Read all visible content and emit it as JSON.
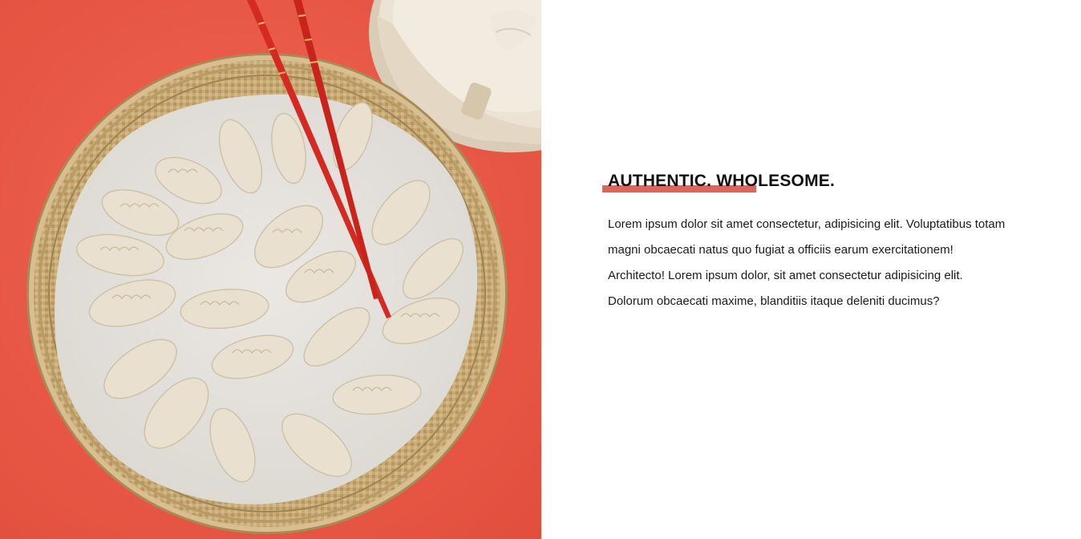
{
  "photo": {
    "icon": "dumplings-photo-icon",
    "colors": {
      "background": "#ec5a47",
      "basket": "#c9ac7a",
      "paper": "#e4e1dc",
      "dumpling": "#e8dfcf",
      "chopsticks": "#d42a22",
      "steamer": "#ece3d4"
    }
  },
  "section": {
    "heading": "AUTHENTIC. WHOLESOME.",
    "accent_color": "#e0645a",
    "body_lines": [
      "Lorem ipsum dolor sit amet consectetur, adipisicing elit. Voluptatibus totam",
      "magni obcaecati natus quo fugiat a officiis earum exercitationem!",
      "Architecto! Lorem ipsum dolor, sit amet consectetur adipisicing elit.",
      "Dolorum obcaecati maxime, blanditiis itaque deleniti ducimus?"
    ]
  }
}
